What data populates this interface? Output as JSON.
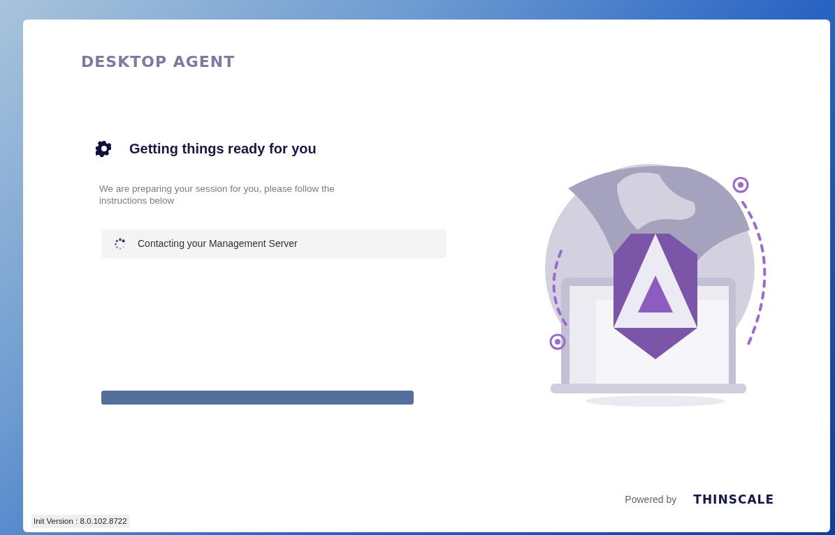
{
  "app_title": "DESKTOP AGENT",
  "heading": "Getting things ready for you",
  "description": "We are preparing your session for you, please follow the instructions below",
  "steps": [
    {
      "label": "Contacting your Management Server",
      "in_progress": true
    }
  ],
  "progress": {
    "level": 1
  },
  "footer": {
    "powered_by": "Powered by",
    "brand": "THINSCALE"
  },
  "version": "Init Version : 8.0.102.8722"
}
